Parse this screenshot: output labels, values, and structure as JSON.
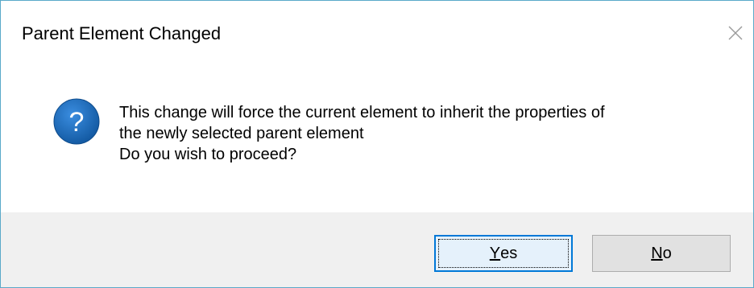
{
  "dialog": {
    "title": "Parent Element Changed",
    "close_icon": "close-icon",
    "question_icon": "question-icon",
    "accent_color": "#0078d7",
    "icon_color": "#1c6fc4",
    "message_lines": [
      "This change will force the current element to inherit the properties of",
      "the newly selected parent element",
      "Do you wish to proceed?"
    ],
    "buttons": {
      "yes": {
        "accel": "Y",
        "rest": "es"
      },
      "no": {
        "accel": "N",
        "rest": "o"
      }
    }
  }
}
